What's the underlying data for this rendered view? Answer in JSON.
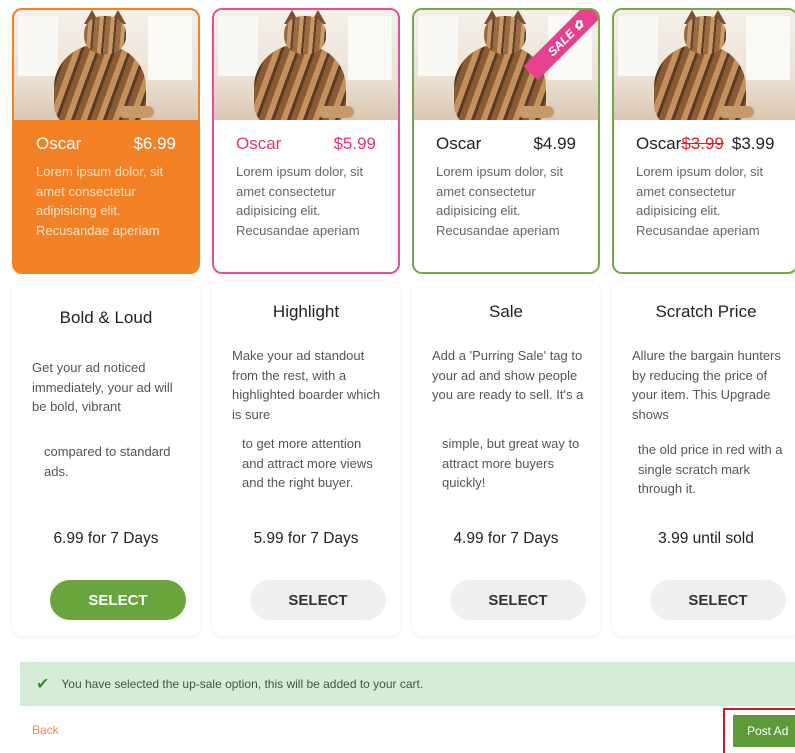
{
  "options": [
    {
      "preview": {
        "name": "Oscar",
        "price": "$6.99",
        "old_price": "",
        "desc": "Lorem ipsum dolor, sit amet consectetur adipisicing elit. Recusandae aperiam"
      },
      "title": "Bold & Loud",
      "desc_top": "Get your ad noticed immediately, your ad will be bold, vibrant",
      "desc_bottom": "compared to standard ads.",
      "price_line": "6.99 for 7 Days",
      "button": "SELECT",
      "selected": true
    },
    {
      "preview": {
        "name": "Oscar",
        "price": "$5.99",
        "old_price": "",
        "desc": "Lorem ipsum dolor, sit amet consectetur adipisicing elit. Recusandae aperiam"
      },
      "title": "Highlight",
      "desc_top": "Make your ad standout from the rest, with a highlighted boarder which is sure",
      "desc_bottom": "to get more attention and attract more views and the right buyer.",
      "price_line": "5.99 for 7 Days",
      "button": "SELECT",
      "selected": false
    },
    {
      "preview": {
        "name": "Oscar",
        "price": "$4.99",
        "old_price": "",
        "desc": "Lorem ipsum dolor, sit amet consectetur adipisicing elit. Recusandae aperiam",
        "badge": "SALE"
      },
      "title": "Sale",
      "desc_top": "Add a 'Purring Sale' tag to your ad and show people you are ready to sell. It's a",
      "desc_bottom": "simple, but great way to attract more buyers quickly!",
      "price_line": "4.99 for 7 Days",
      "button": "SELECT",
      "selected": false
    },
    {
      "preview": {
        "name": "Oscar",
        "price": "$3.99",
        "old_price": "$3.99",
        "desc": "Lorem ipsum dolor, sit amet consectetur adipisicing elit. Recusandae aperiam"
      },
      "title": "Scratch Price",
      "desc_top": "Allure the bargain hunters by reducing the price of your item. This Upgrade shows",
      "desc_bottom": "the old price in red with a single scratch mark through it.",
      "price_line": "3.99 until sold",
      "button": "SELECT",
      "selected": false
    }
  ],
  "notice": "You have selected the up-sale option, this will be added to your cart.",
  "footer": {
    "back": "Back",
    "post": "Post Ad"
  },
  "colors": {
    "orange": "#f28024",
    "pink": "#e54e99",
    "green": "#77a84a",
    "select_green": "#6aa43c"
  },
  "icons": {
    "notice": "checkmark-icon",
    "photo": "cat-photo",
    "badge": "paw-icon"
  }
}
